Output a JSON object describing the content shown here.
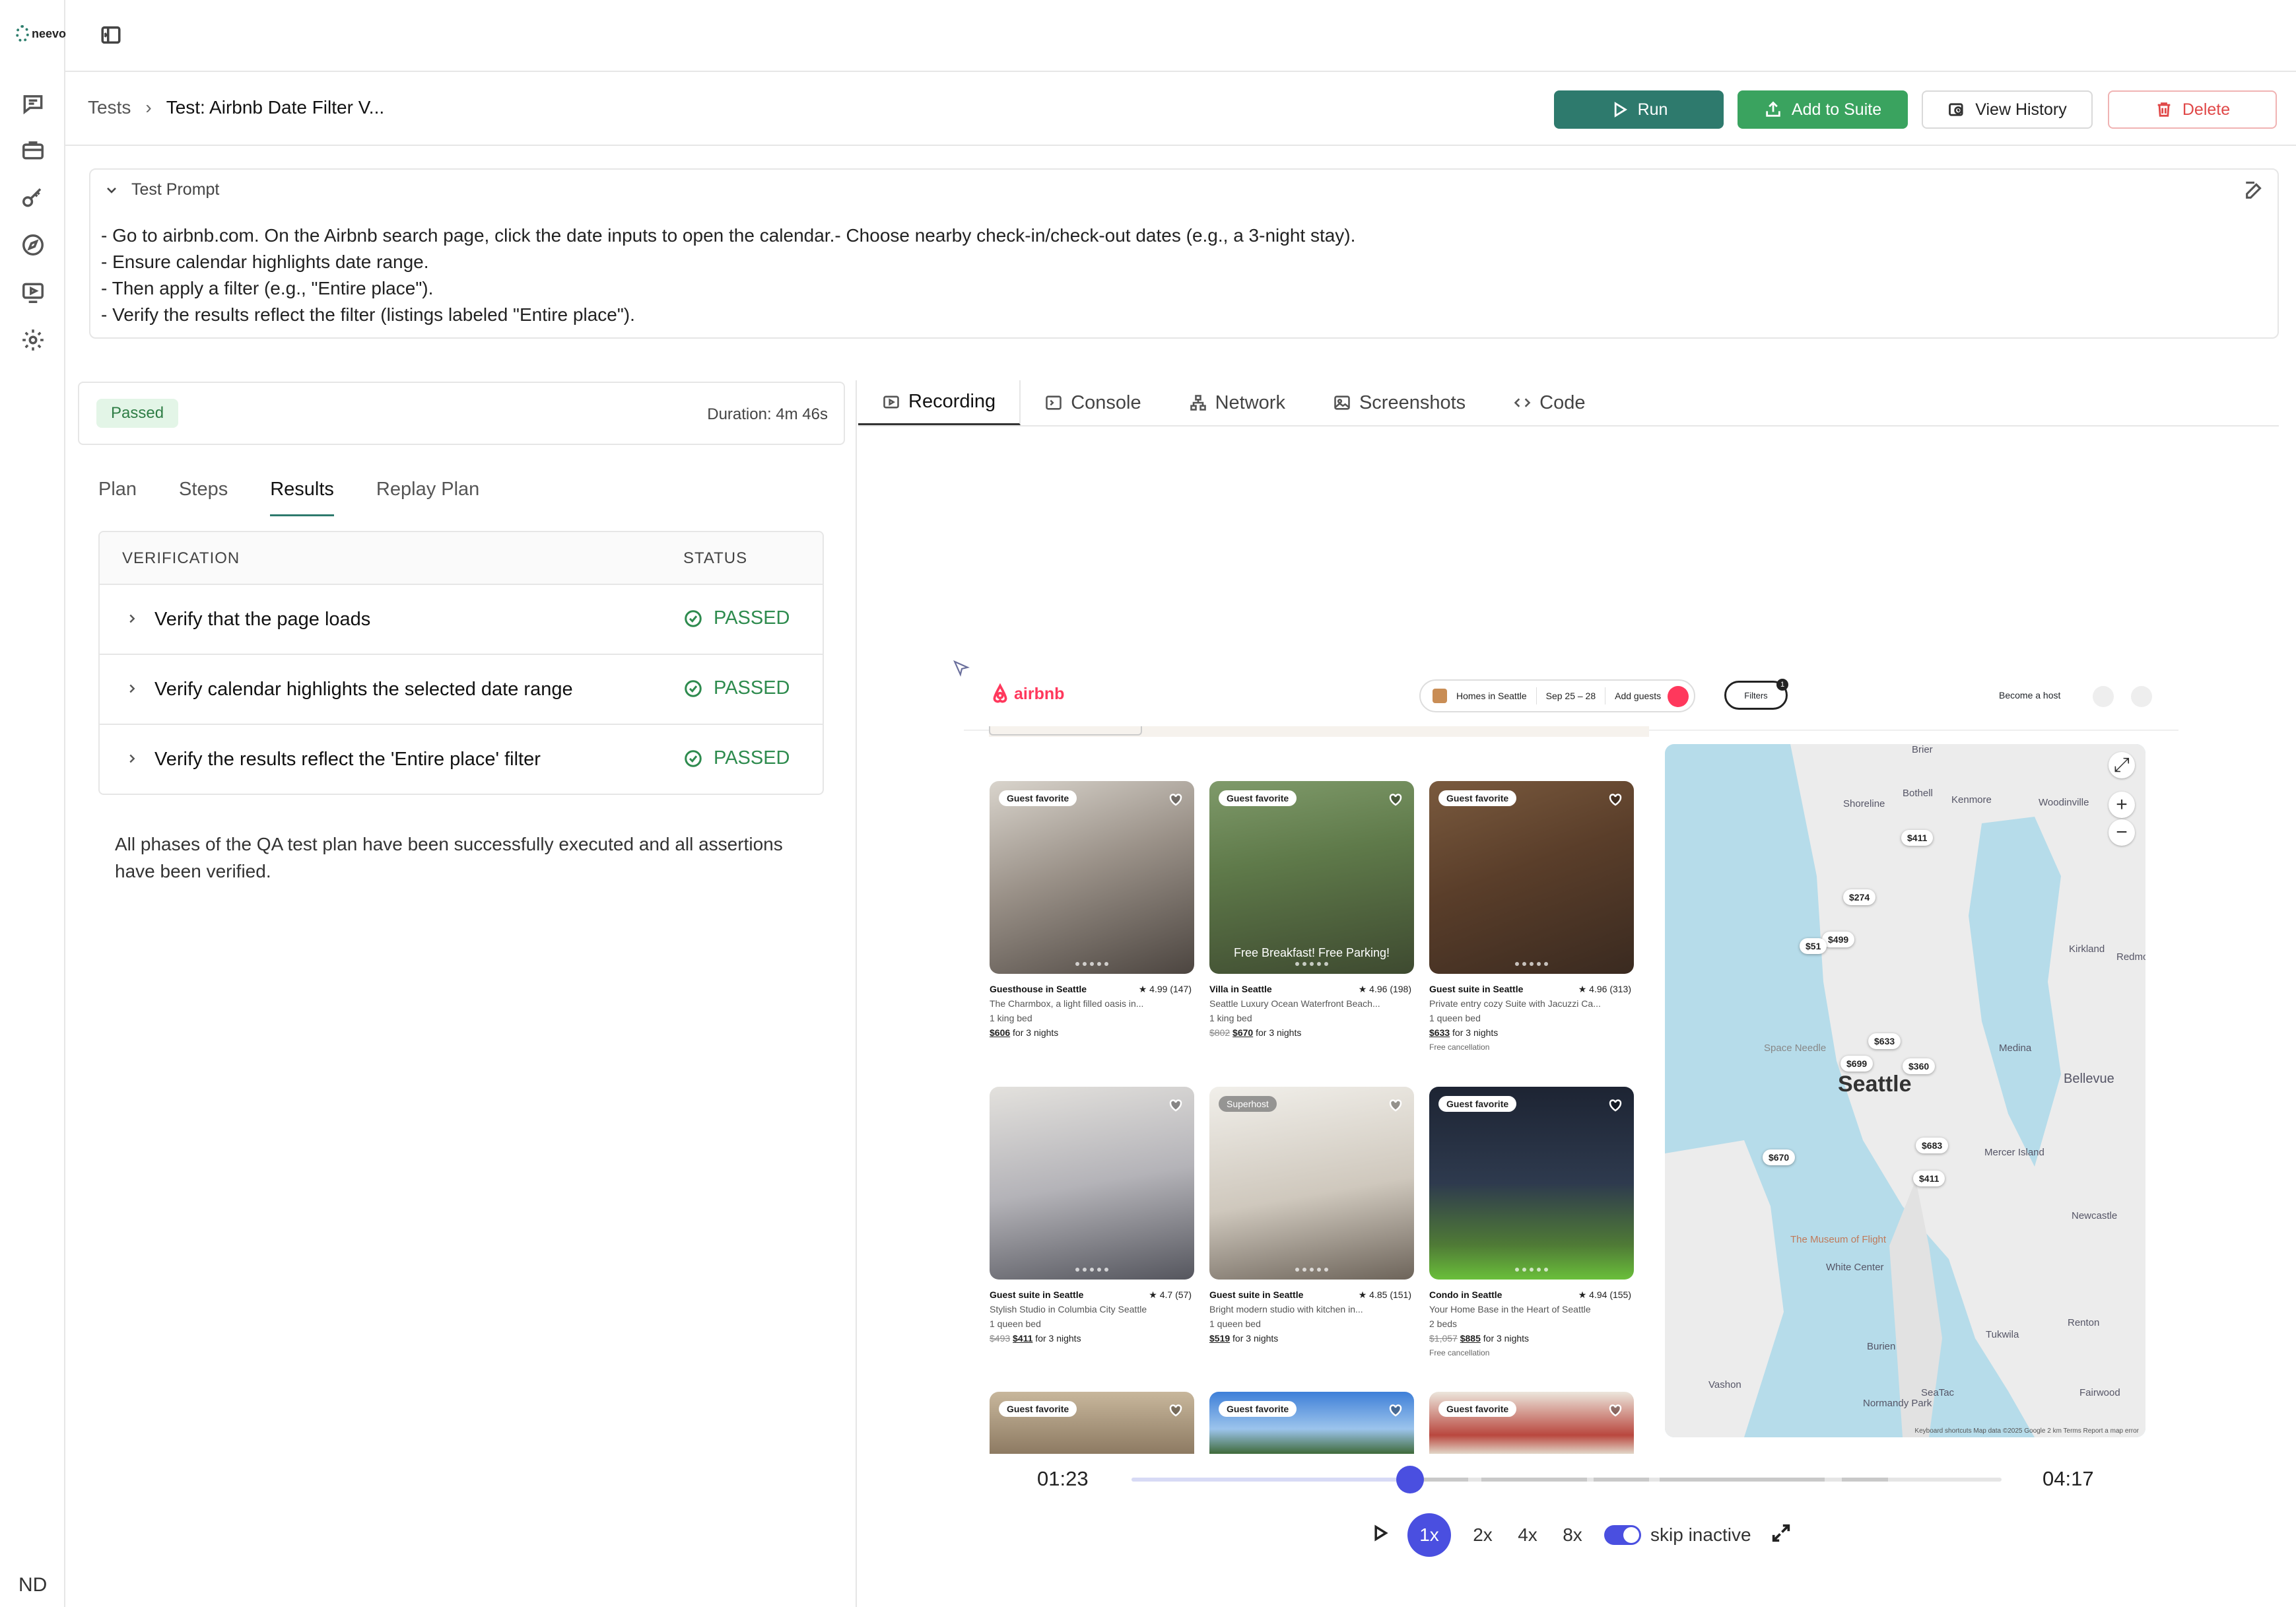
{
  "app": {
    "logo_text": "neevo",
    "user_initials": "ND"
  },
  "breadcrumb": {
    "root": "Tests",
    "current": "Test: Airbnb Date Filter V..."
  },
  "header_actions": {
    "run": "Run",
    "add_to_suite": "Add to Suite",
    "view_history": "View History",
    "delete": "Delete"
  },
  "prompt": {
    "title": "Test Prompt",
    "lines": [
      "- Go to airbnb.com. On the Airbnb search page, click the date inputs to open the calendar.- Choose nearby check-in/check-out dates (e.g., a 3-night stay).",
      "- Ensure calendar highlights date range.",
      "- Then apply a filter (e.g., \"Entire place\").",
      "- Verify the results reflect the filter (listings labeled \"Entire place\")."
    ]
  },
  "run_status": {
    "badge": "Passed",
    "duration": "Duration: 4m 46s"
  },
  "left_tabs": [
    "Plan",
    "Steps",
    "Results",
    "Replay Plan"
  ],
  "results": {
    "col_verification": "VERIFICATION",
    "col_status": "STATUS",
    "rows": [
      {
        "text": "Verify that the page loads",
        "status": "PASSED"
      },
      {
        "text": "Verify calendar highlights the selected date range",
        "status": "PASSED"
      },
      {
        "text": "Verify the results reflect the 'Entire place' filter",
        "status": "PASSED"
      }
    ],
    "summary": "All phases of the QA test plan have been successfully executed and all assertions have been verified."
  },
  "right_tabs": [
    "Recording",
    "Console",
    "Network",
    "Screenshots",
    "Code"
  ],
  "airbnb": {
    "logo": "airbnb",
    "search_location": "Homes in Seattle",
    "search_dates": "Sep 25 – 28",
    "search_guests": "Add guests",
    "filters_label": "Filters",
    "filters_count": "1",
    "become_host": "Become a host",
    "listings": [
      {
        "tag": "Guest favorite",
        "title": "Guesthouse in Seattle",
        "rating": "★ 4.99 (147)",
        "desc": "The Charmbox, a light filled oasis in...",
        "beds": "1 king bed",
        "old_price": "",
        "price": "$606",
        "suffix": " for 3 nights",
        "note": ""
      },
      {
        "tag": "Guest favorite",
        "title": "Villa in Seattle",
        "rating": "★ 4.96 (198)",
        "desc": "Seattle Luxury Ocean Waterfront Beach...",
        "beds": "1 king bed",
        "old_price": "$802",
        "price": "$670",
        "suffix": " for 3 nights",
        "note": "",
        "overlay": "Free Breakfast! Free Parking!"
      },
      {
        "tag": "Guest favorite",
        "title": "Guest suite in Seattle",
        "rating": "★ 4.96 (313)",
        "desc": "Private entry cozy Suite with Jacuzzi Ca...",
        "beds": "1 queen bed",
        "old_price": "",
        "price": "$633",
        "suffix": " for 3 nights",
        "note": "Free cancellation"
      },
      {
        "tag": "",
        "title": "Guest suite in Seattle",
        "rating": "★ 4.7 (57)",
        "desc": "Stylish Studio in Columbia City Seattle",
        "beds": "1 queen bed",
        "old_price": "$493",
        "price": "$411",
        "suffix": " for 3 nights",
        "note": ""
      },
      {
        "tag": "Superhost",
        "title": "Guest suite in Seattle",
        "rating": "★ 4.85 (151)",
        "desc": "Bright modern studio with kitchen in...",
        "beds": "1 queen bed",
        "old_price": "",
        "price": "$519",
        "suffix": " for 3 nights",
        "note": ""
      },
      {
        "tag": "Guest favorite",
        "title": "Condo in Seattle",
        "rating": "★ 4.94 (155)",
        "desc": "Your Home Base in the Heart of Seattle",
        "beds": "2 beds",
        "old_price": "$1,057",
        "price": "$885",
        "suffix": " for 3 nights",
        "note": "Free cancellation"
      }
    ],
    "partial_tags": [
      "Guest favorite",
      "Guest favorite",
      "Guest favorite"
    ],
    "map_pins": [
      "$411",
      "$274",
      "$499",
      "$51",
      "$633",
      "$699",
      "$360",
      "$683",
      "$411",
      "$670"
    ],
    "map_labels": [
      "Shoreline",
      "Kenmore",
      "Bothell",
      "Kirkland",
      "Medina",
      "Bellevue",
      "Mercer Island",
      "Newcastle",
      "Renton",
      "Tukwila",
      "White Center",
      "Burien",
      "Vashon",
      "Space Needle",
      "The Museum of Flight",
      "Woodinville",
      "Redmond",
      "SeaTac",
      "Normandy Park",
      "Fairwood",
      "Brier"
    ],
    "map_city": "Seattle",
    "map_footer": "Keyboard shortcuts   Map data ©2025 Google   2 km   Terms   Report a map error"
  },
  "playback": {
    "current": "01:23",
    "total": "04:17",
    "progress": 0.32,
    "speeds": [
      "1x",
      "2x",
      "4x",
      "8x"
    ],
    "active_speed": "1x",
    "skip_inactive": "skip inactive"
  },
  "colors": {
    "accent": "#2e7a6d",
    "suite": "#3aa35f",
    "danger": "#e04848",
    "passed": "#2e8b4e",
    "player": "#4a4fe0",
    "airbnb": "#ff385c"
  }
}
